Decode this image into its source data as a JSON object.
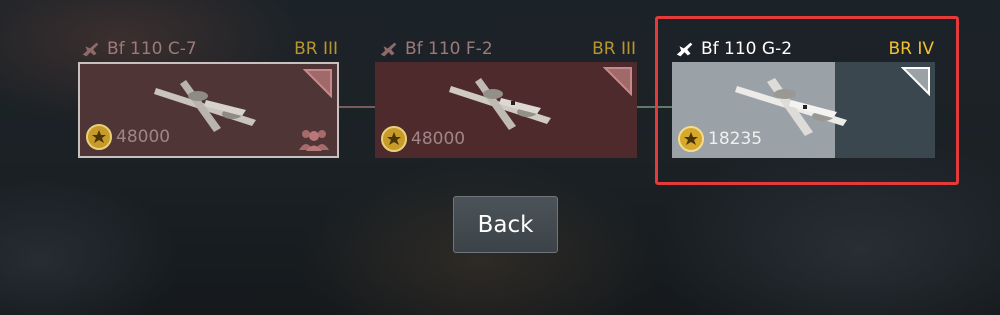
{
  "vehicles": [
    {
      "name": "Bf 110 C-7",
      "br": "BR III",
      "cost": "48000"
    },
    {
      "name": "Bf 110 F-2",
      "br": "BR III",
      "cost": "48000"
    },
    {
      "name": "Bf 110 G-2",
      "br": "BR IV",
      "cost": "18235"
    }
  ],
  "back_label": "Back",
  "colors": {
    "highlight": "#e53a3a",
    "br_gold": "#b8962e",
    "br_active": "#f2c12e"
  }
}
